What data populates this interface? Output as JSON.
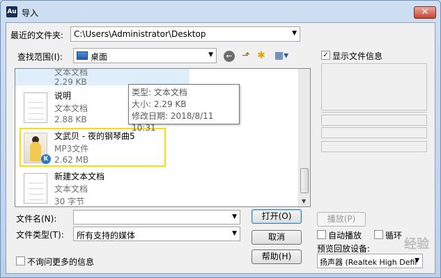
{
  "window": {
    "app_icon_text": "Au",
    "title": "导入",
    "close_label": "✕"
  },
  "recent": {
    "label": "最近的文件夹:",
    "value": "C:\\Users\\Administrator\\Desktop"
  },
  "lookin": {
    "label": "查找范围(I):",
    "value": "桌面"
  },
  "list": {
    "partial_item": {
      "type": "文本文档",
      "size": "2.29 KB"
    },
    "items": [
      {
        "name": "说明",
        "type": "文本文档",
        "size": "2.88 KB",
        "icon": "text-document-icon"
      },
      {
        "name": "文武贝 - 夜的钢琴曲5",
        "type": "MP3文件",
        "size": "2.62 MB",
        "icon": "mp3-album-art"
      },
      {
        "name": "新建文本文档",
        "type": "文本文档",
        "size": "30 字节",
        "icon": "text-document-icon"
      }
    ],
    "badge_text": "K"
  },
  "tooltip": {
    "type_line": "类型: 文本文档",
    "size_line": "大小: 2.29 KB",
    "date_line": "修改日期: 2018/8/11 10:31"
  },
  "filename": {
    "label": "文件名(N):",
    "value": ""
  },
  "filetype": {
    "label": "文件类型(T):",
    "value": "所有支持的媒体"
  },
  "buttons": {
    "open": "打开(O)",
    "cancel": "取消",
    "help": "帮助(H)",
    "play": "播放(P)"
  },
  "dont_ask": {
    "label": "不询问更多的信息",
    "checked": false
  },
  "info_panel": {
    "show_info_label": "显示文件信息",
    "checked": true
  },
  "playback": {
    "autoplay_label": "自动播放",
    "autoplay_checked": false,
    "loop_label": "循环",
    "loop_checked": false,
    "device_label": "预览回放设备:",
    "device_value": "扬声器 (Realtek High Defir"
  },
  "watermark": "经验"
}
